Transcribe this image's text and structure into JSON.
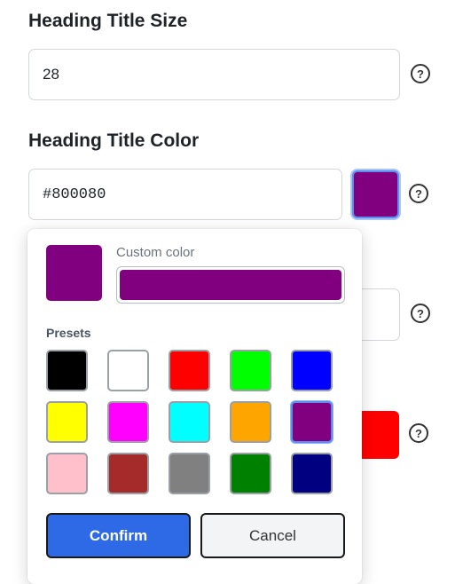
{
  "size_field": {
    "label": "Heading Title Size",
    "value": "28"
  },
  "color_field": {
    "label": "Heading Title Color",
    "value": "#800080",
    "swatch": "#800080"
  },
  "help_glyph": "?",
  "hidden_swatch": "#ff0000",
  "picker": {
    "preview_color": "#800080",
    "custom_label": "Custom color",
    "custom_value": "#800080",
    "presets_label": "Presets",
    "presets": [
      "#000000",
      "#ffffff",
      "#ff0000",
      "#00ff00",
      "#0000ff",
      "#ffff00",
      "#ff00ff",
      "#00ffff",
      "#ffa500",
      "#800080",
      "#ffc0cb",
      "#a52a2a",
      "#808080",
      "#008000",
      "#000080"
    ],
    "selected_index": 9,
    "confirm_label": "Confirm",
    "cancel_label": "Cancel"
  }
}
